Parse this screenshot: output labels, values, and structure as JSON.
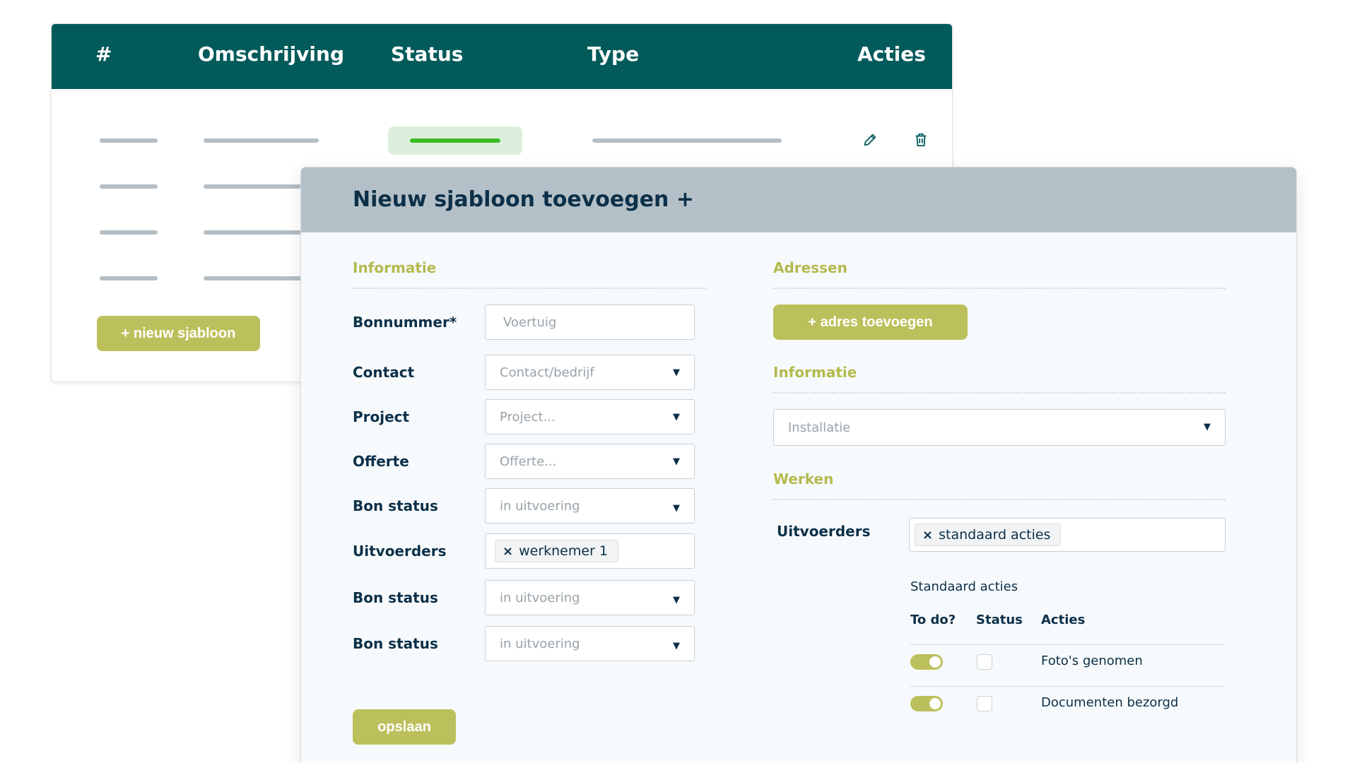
{
  "table": {
    "headers": [
      "#",
      "Omschrijving",
      "Status",
      "Type",
      "Acties"
    ],
    "new_template_button": "+ nieuw sjabloon"
  },
  "modal": {
    "title": "Nieuw sjabloon toevoegen +",
    "left": {
      "section_title": "Informatie",
      "fields": {
        "bonnummer": {
          "label": "Bonnummer*",
          "placeholder": "Voertuig"
        },
        "contact": {
          "label": "Contact",
          "value": "Contact/bedrijf"
        },
        "project": {
          "label": "Project",
          "value": "Project..."
        },
        "offerte": {
          "label": "Offerte",
          "value": "Offerte..."
        },
        "bon_status_1": {
          "label": "Bon status",
          "value": "in uitvoering"
        },
        "uitvoerders": {
          "label": "Uitvoerders",
          "tag": "werknemer 1"
        },
        "bon_status_2": {
          "label": "Bon status",
          "value": "in uitvoering"
        },
        "bon_status_3": {
          "label": "Bon status",
          "value": "in uitvoering"
        }
      },
      "save_button": "opslaan"
    },
    "right": {
      "adressen_title": "Adressen",
      "add_address_button": "+ adres toevoegen",
      "informatie_title": "Informatie",
      "installatie_value": "Installatie",
      "werken_title": "Werken",
      "uitvoerders_label": "Uitvoerders",
      "uitvoerders_tag": "standaard acties",
      "standaard_acties_label": "Standaard acties",
      "columns": {
        "todo": "To do?",
        "status": "Status",
        "acties": "Acties"
      },
      "rows": [
        {
          "todo": true,
          "status": false,
          "actie": "Foto's genomen"
        },
        {
          "todo": true,
          "status": false,
          "actie": "Documenten bezorgd"
        }
      ]
    }
  },
  "colors": {
    "table_header": "#035a5b",
    "modal_header": "#b4c0c7",
    "accent_olive": "#bcc05c",
    "status_green": "#3dbb24",
    "text_dark": "#0c3049"
  },
  "icons": {
    "edit": "pencil-icon",
    "delete": "trash-icon",
    "dropdown": "caret-down-icon",
    "remove_tag": "close-icon"
  }
}
